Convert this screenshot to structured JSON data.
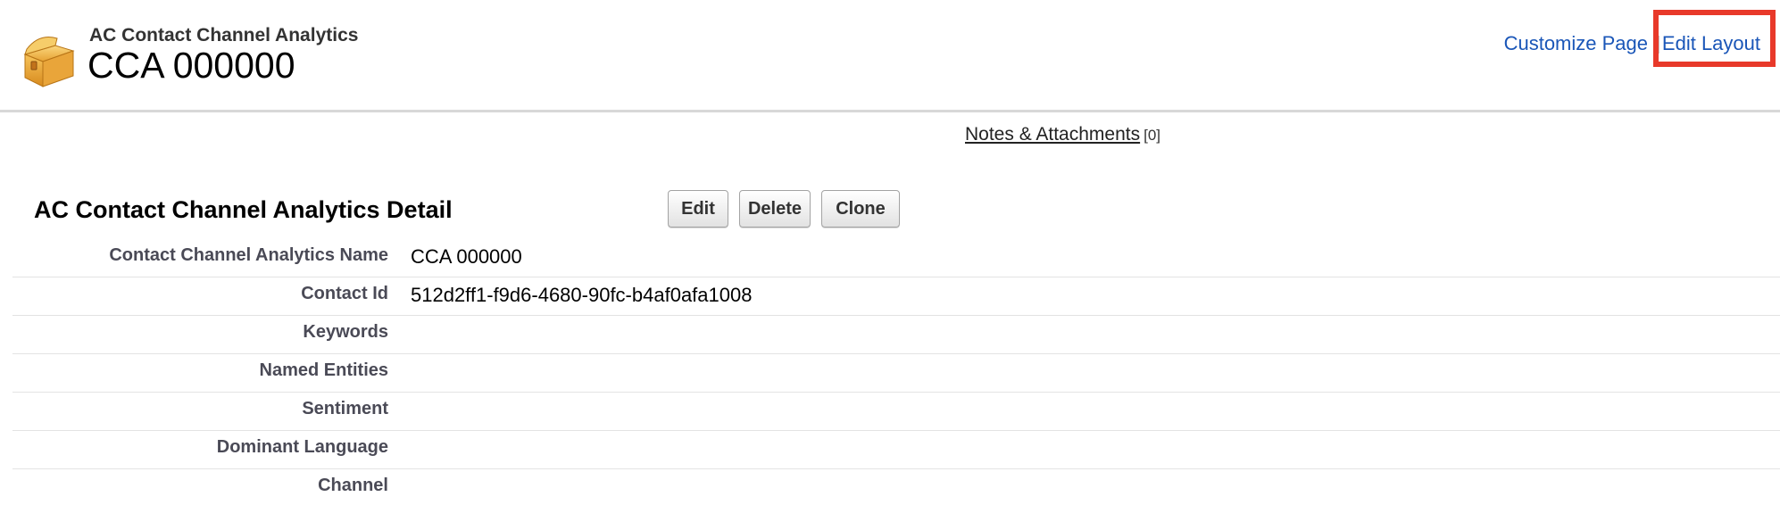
{
  "header": {
    "object_type": "AC Contact Channel Analytics",
    "record_name": "CCA 000000",
    "icon": "treasure-chest-icon",
    "links": {
      "customize_page": "Customize Page",
      "edit_layout": "Edit Layout"
    }
  },
  "related": {
    "notes_attachments_label": "Notes & Attachments",
    "notes_attachments_count": "[0]"
  },
  "detail": {
    "title": "AC Contact Channel Analytics Detail",
    "buttons": {
      "edit": "Edit",
      "delete": "Delete",
      "clone": "Clone"
    },
    "fields": [
      {
        "label": "Contact Channel Analytics Name",
        "value": "CCA 000000"
      },
      {
        "label": "Contact Id",
        "value": "512d2ff1-f9d6-4680-90fc-b4af0afa1008"
      },
      {
        "label": "Keywords",
        "value": ""
      },
      {
        "label": "Named Entities",
        "value": ""
      },
      {
        "label": "Sentiment",
        "value": ""
      },
      {
        "label": "Dominant Language",
        "value": ""
      },
      {
        "label": "Channel",
        "value": ""
      }
    ]
  },
  "colors": {
    "link": "#1a56b8",
    "highlight": "#e8392a",
    "label": "#4a4a56"
  }
}
